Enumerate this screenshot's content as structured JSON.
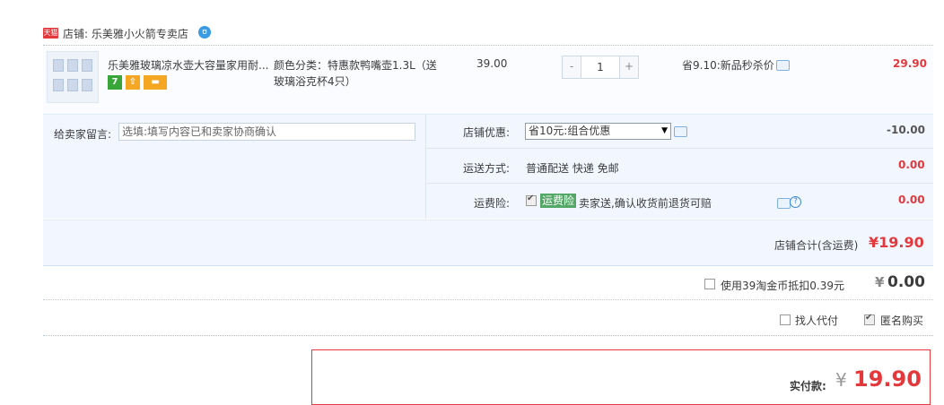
{
  "shop": {
    "badge": "天猫",
    "label": "店铺: 乐美雅小火箭专卖店",
    "wangwang_glyph": "ʊ"
  },
  "item": {
    "title": "乐美雅玻璃凉水壶大容量家用耐...",
    "sku_line1": "颜色分类：特惠款鸭嘴壶1.3L（送",
    "sku_line2": "玻璃浴克杯4只）",
    "unit_price": "39.00",
    "quantity": "1",
    "qty_minus": "-",
    "qty_plus": "+",
    "promo": "省9.10:新品秒杀价",
    "total": "29.90",
    "service_icons": [
      {
        "glyph": "7",
        "color": "#39a63a"
      },
      {
        "glyph": "⇧",
        "color": "#f5a623"
      },
      {
        "glyph": "▬",
        "color": "#f5a623"
      }
    ]
  },
  "order": {
    "message_label": "给卖家留言:",
    "message_placeholder": "选填:填写内容已和卖家协商确认",
    "discount_label": "店铺优惠:",
    "discount_selected": "省10元:组合优惠",
    "discount_amount": "-10.00",
    "shipping_label": "运送方式:",
    "shipping_value": "普通配送 快递 免邮",
    "shipping_amount": "0.00",
    "insurance_label": "运费险:",
    "insurance_tag": "运费险",
    "insurance_desc": "卖家送,确认收货前退货可赔",
    "insurance_amount": "0.00",
    "subtotal_label": "店铺合计(含运费)",
    "subtotal_amount": "¥19.90"
  },
  "coins": {
    "label": "使用39淘金币抵扣0.39元",
    "amount_symbol": "¥",
    "amount": "0.00"
  },
  "options": {
    "proxy_pay": "找人代付",
    "anonymous": "匿名购买",
    "anonymous_checked": true
  },
  "payment": {
    "label": "实付款:",
    "symbol": "¥",
    "amount": "19.90"
  },
  "colors": {
    "accent_red": "#e4393c",
    "panel_blue": "#f2f7ff",
    "insurance_green": "#53a867"
  }
}
